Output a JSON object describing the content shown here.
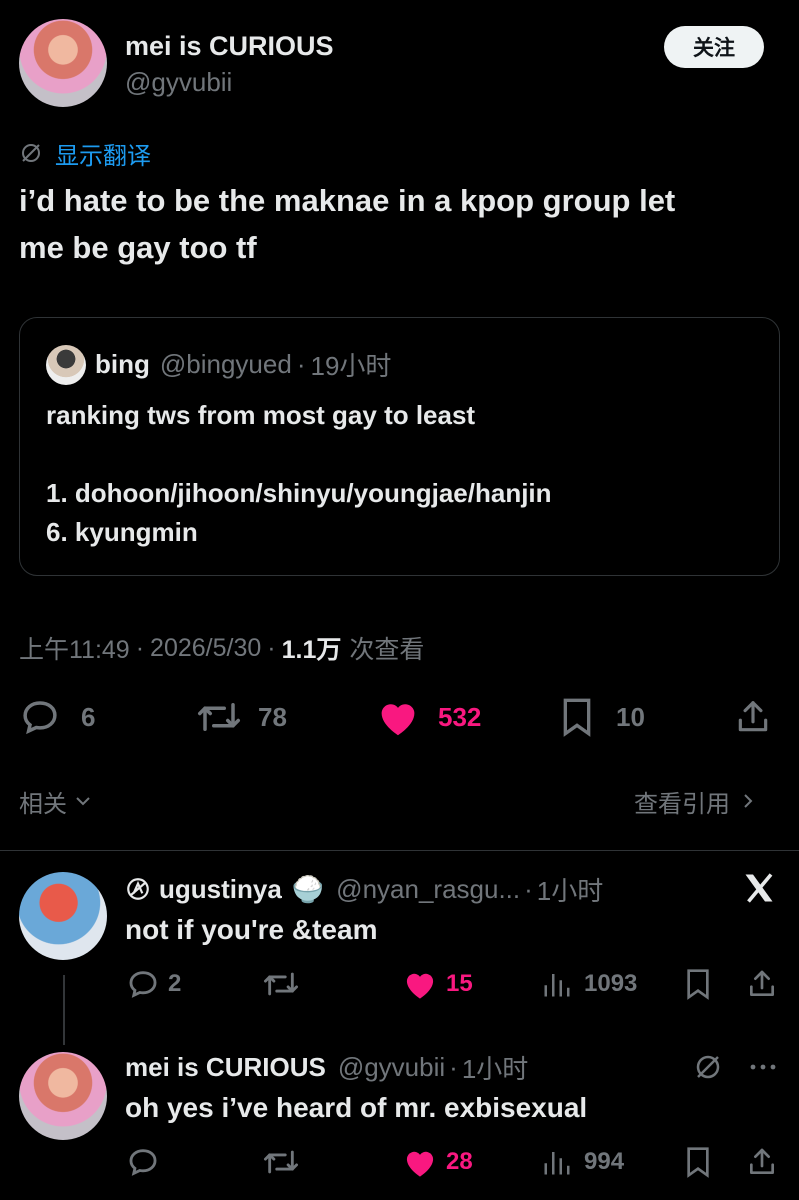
{
  "main_tweet": {
    "author_name": "mei is CURIOUS",
    "author_handle": "@gyvubii",
    "follow_label": "关注",
    "translate_label": "显示翻译",
    "text_line1": "i’d hate to be the maknae in a kpop group let",
    "text_line2": "me be gay too tf",
    "meta": {
      "time": "上午11:49",
      "sep1": "·",
      "date": "2026/5/30",
      "sep2": "·",
      "views_count": "1.1万",
      "views_label": "次查看"
    },
    "actions": {
      "replies": "6",
      "retweets": "78",
      "likes": "532",
      "bookmarks": "10"
    }
  },
  "quoted_tweet": {
    "author_name": "bing",
    "author_handle": "@bingyued",
    "sep": "·",
    "time": "19小时",
    "line1": "ranking tws from most gay to least",
    "line2": "1. dohoon/jihoon/shinyu/youngjae/hanjin",
    "line3": "6. kyungmin"
  },
  "related": {
    "label": "相关",
    "quotes_link": "查看引用"
  },
  "replies": [
    {
      "author_name": "ugustinya",
      "emoji": "🍚",
      "author_handle": "@nyan_rasgu...",
      "sep": "·",
      "time": "1小时",
      "text": "not if you're &team",
      "replies": "2",
      "retweets": "",
      "likes": "15",
      "views": "1093"
    },
    {
      "author_name": "mei is CURIOUS",
      "author_handle": "@gyvubii",
      "sep": "·",
      "time": "1小时",
      "text": "oh yes i’ve heard of mr. exbisexual",
      "replies": "",
      "retweets": "",
      "likes": "28",
      "views": "994"
    }
  ],
  "colors": {
    "background": "#000000",
    "text": "#e7e9ea",
    "secondary": "#71767b",
    "link_blue": "#1d9bf0",
    "like_pink": "#f91880",
    "border": "#2f3336"
  },
  "icons": {
    "translate": "globe-slash-icon",
    "reply": "speech-bubble-icon",
    "retweet": "retweet-arrows-icon",
    "like": "heart-icon",
    "bookmark": "bookmark-icon",
    "share": "share-upload-icon",
    "views": "bar-chart-icon",
    "x_logo": "x-logo-icon",
    "more": "more-dots-icon",
    "grok": "grok-icon",
    "chevron_down": "chevron-down-icon",
    "chevron_right": "chevron-right-icon"
  }
}
